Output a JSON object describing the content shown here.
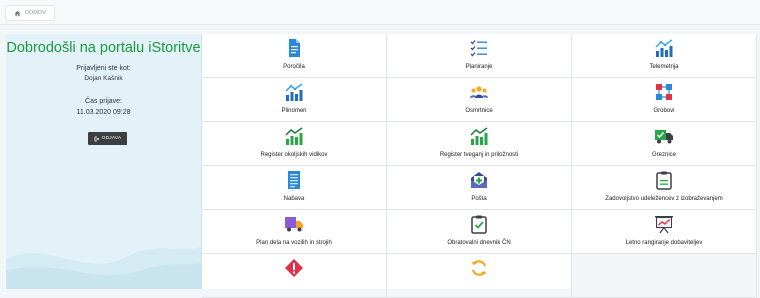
{
  "breadcrumb": {
    "home_label": "DOMOV"
  },
  "welcome": {
    "title": "Dobrodošli na portalu iStoritve",
    "logged_in_label": "Prijavljeni ste kot:",
    "username": "Dojan Kašnik",
    "login_time_label": "Čas prijave:",
    "login_time": "11.03.2020 09:28",
    "logout_label": "ODJAVA"
  },
  "tiles": [
    {
      "label": "Poročila",
      "icon": "document-icon"
    },
    {
      "label": "Planiranje",
      "icon": "checklist-icon"
    },
    {
      "label": "Telemetrija",
      "icon": "bar-chart-line-icon"
    },
    {
      "label": "Plinomeri",
      "icon": "bar-chart-line-icon"
    },
    {
      "label": "Osmrtnice",
      "icon": "people-group-icon"
    },
    {
      "label": "Grobovi",
      "icon": "network-icon"
    },
    {
      "label": "Register okoljskih vidikov",
      "icon": "green-chart-icon"
    },
    {
      "label": "Register tveganj in priložnosti",
      "icon": "green-chart-icon"
    },
    {
      "label": "Greznice",
      "icon": "truck-check-icon"
    },
    {
      "label": "Nabava",
      "icon": "list-document-icon"
    },
    {
      "label": "Pošta",
      "icon": "mail-plus-icon"
    },
    {
      "label": "Zadovoljstvo udeležencev z izobraževanjem",
      "icon": "clipboard-icon"
    },
    {
      "label": "Plan dela na vozilih in strojih",
      "icon": "delivery-truck-icon"
    },
    {
      "label": "Obratovalni dnevnik ČN",
      "icon": "clipboard-check-icon"
    },
    {
      "label": "Letno rangiranje dobaviteljev",
      "icon": "presentation-chart-icon"
    },
    {
      "label": "",
      "icon": "warning-icon"
    },
    {
      "label": "",
      "icon": "refresh-icon"
    }
  ],
  "colors": {
    "title_green": "#1a9a3c",
    "panel_bg": "#e3f2f8",
    "icon_blue": "#2a88d8",
    "icon_green": "#28a745",
    "icon_orange": "#f5a623"
  }
}
